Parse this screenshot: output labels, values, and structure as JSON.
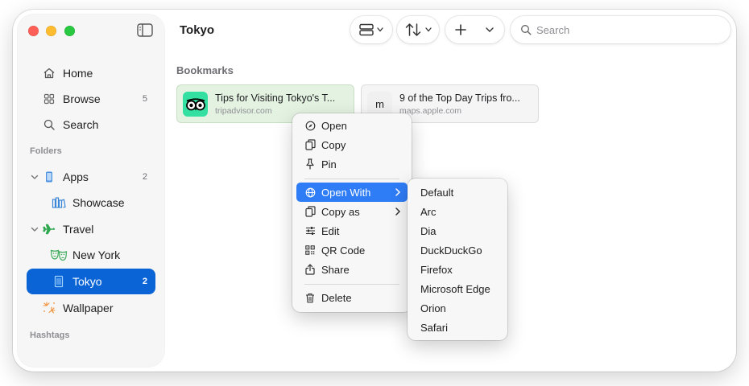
{
  "window": {
    "title": "Tokyo"
  },
  "sidebar": {
    "nav": [
      {
        "label": "Home",
        "count": ""
      },
      {
        "label": "Browse",
        "count": "5"
      },
      {
        "label": "Search",
        "count": ""
      }
    ],
    "folders_label": "Folders",
    "folders": [
      {
        "label": "Apps",
        "count": "2"
      },
      {
        "label": "Showcase",
        "count": ""
      },
      {
        "label": "Travel",
        "count": ""
      },
      {
        "label": "New York",
        "count": ""
      },
      {
        "label": "Tokyo",
        "count": "2"
      },
      {
        "label": "Wallpaper",
        "count": ""
      }
    ],
    "hashtags_label": "Hashtags"
  },
  "toolbar": {
    "search_placeholder": "Search"
  },
  "content": {
    "section_title": "Bookmarks",
    "bookmarks": [
      {
        "title": "Tips for Visiting Tokyo's T...",
        "url": "tripadvisor.com",
        "thumb_icon": "tripadvisor-owl-icon"
      },
      {
        "title": "9 of the Top Day Trips fro...",
        "url": "maps.apple.com",
        "thumb_letter": "m"
      }
    ]
  },
  "context_menu": {
    "items": [
      {
        "label": "Open",
        "icon": "compass-icon"
      },
      {
        "label": "Copy",
        "icon": "copy-icon"
      },
      {
        "label": "Pin",
        "icon": "pin-icon"
      },
      {
        "label": "Open With",
        "icon": "globe-icon",
        "submenu": true
      },
      {
        "label": "Copy as",
        "icon": "copy-icon",
        "submenu": true
      },
      {
        "label": "Edit",
        "icon": "sliders-icon"
      },
      {
        "label": "QR Code",
        "icon": "qrcode-icon"
      },
      {
        "label": "Share",
        "icon": "share-icon"
      },
      {
        "label": "Delete",
        "icon": "trash-icon"
      }
    ]
  },
  "open_with_submenu": {
    "items": [
      "Default",
      "Arc",
      "Dia",
      "DuckDuckGo",
      "Firefox",
      "Microsoft Edge",
      "Orion",
      "Safari"
    ]
  },
  "colors": {
    "accent": "#0a64d6",
    "menu_highlight": "#2e7cf6",
    "bookmark_highlight": "#e4f2e2",
    "tripadvisor_green": "#34e0a1"
  }
}
